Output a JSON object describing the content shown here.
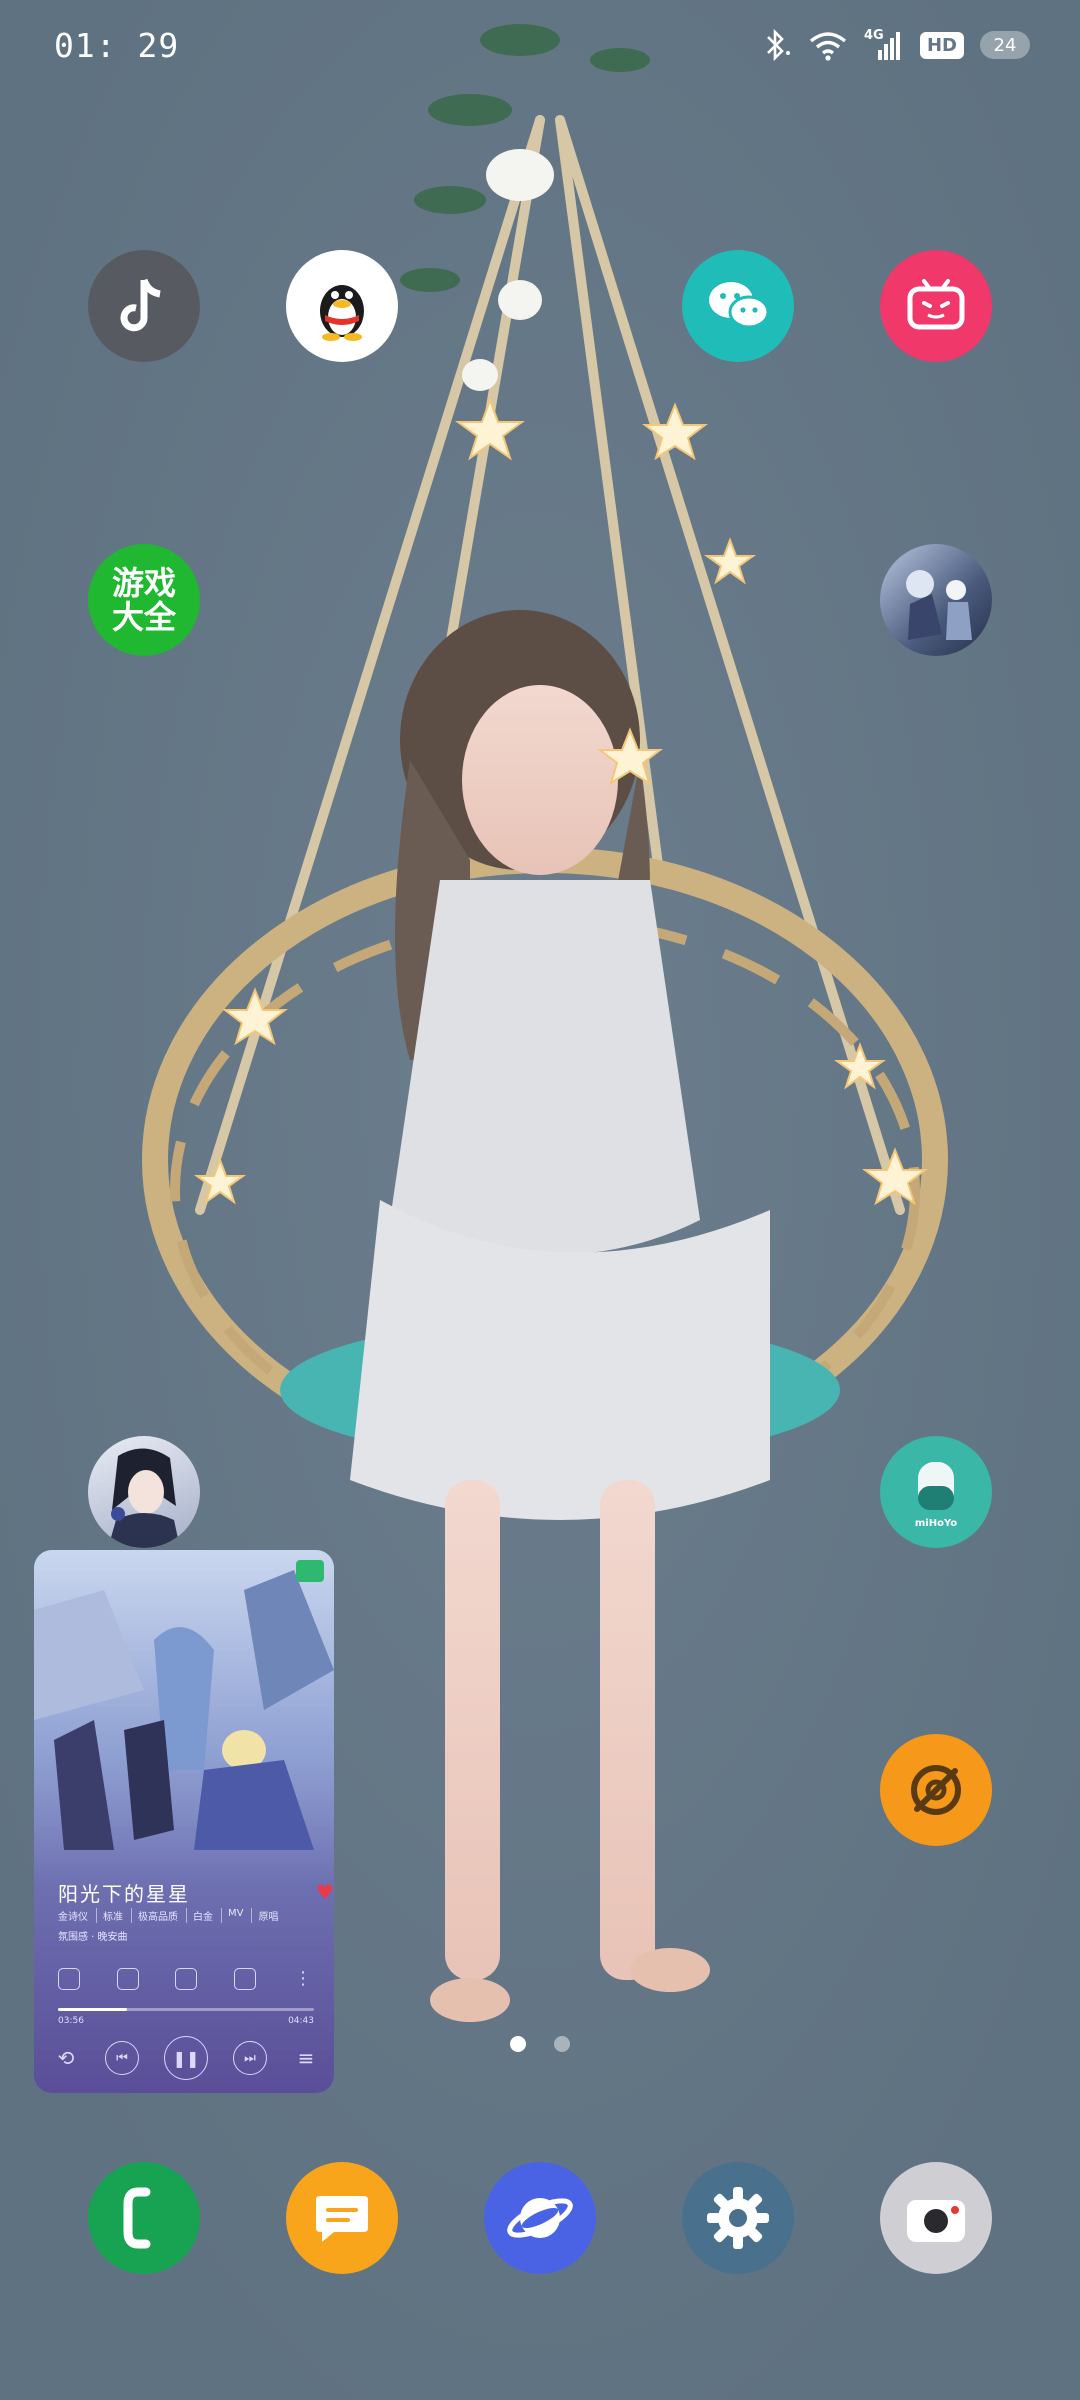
{
  "status_bar": {
    "time": "01: 29",
    "network_label": "4G",
    "hd_label": "HD",
    "battery": "24"
  },
  "home": {
    "game_center_label_line1": "游戏",
    "game_center_label_line2": "大全",
    "mihoyo_label": "miHoYo"
  },
  "music_widget": {
    "song_title": "阳光下的星星",
    "meta": [
      "金诗仪",
      "标准",
      "极高品质",
      "白金",
      "MV",
      "原唱"
    ],
    "sub_text": "氛围感 · 晚安曲",
    "elapsed": "03:56",
    "duration": "04:43",
    "progress": 0.27
  },
  "pager": {
    "pages": 2,
    "active": 0
  },
  "colors": {
    "background": "#657786",
    "tiktok": "#575a60",
    "qq": "#ffffff",
    "wechat": "#1fbcb8",
    "bilibili": "#f0386a",
    "game_center": "#20b830",
    "mihoyo": "#3ab7a6",
    "orange_app": "#f6981a",
    "phone": "#18a352",
    "messages": "#f9a51c",
    "browser": "#4a63e4",
    "settings": "#49708c",
    "camera": "#cfcfd3"
  }
}
